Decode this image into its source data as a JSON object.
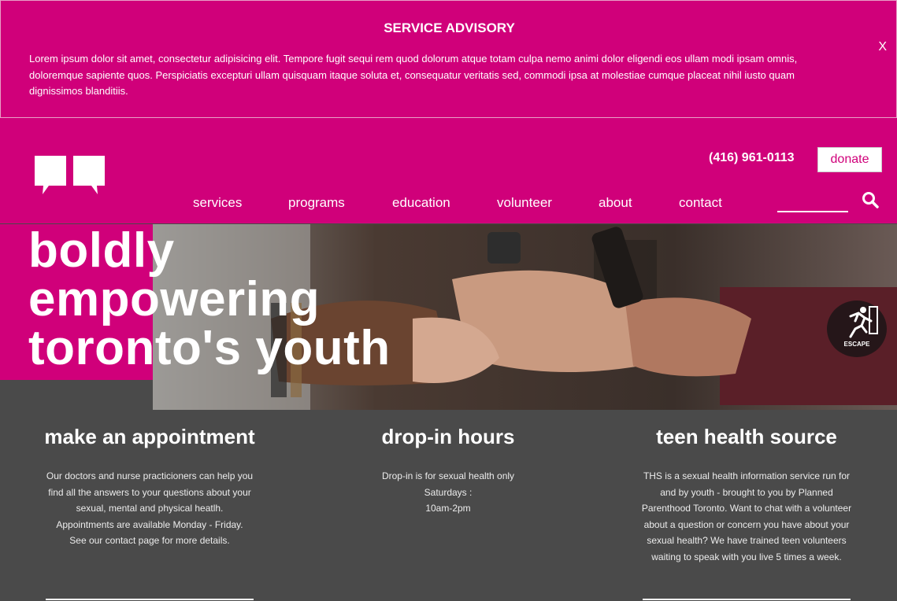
{
  "advisory": {
    "title": "SERVICE ADVISORY",
    "body": "Lorem ipsum dolor sit amet, consectetur adipisicing elit. Tempore fugit sequi rem quod dolorum atque totam culpa nemo animi dolor eligendi eos ullam modi ipsam omnis, doloremque sapiente quos. Perspiciatis excepturi ullam quisquam itaque soluta et, consequatur veritatis sed, commodi ipsa at molestiae cumque placeat nihil iusto quam dignissimos blanditiis.",
    "close_label": "X"
  },
  "header": {
    "phone": "(416) 961-0113",
    "donate_label": "donate",
    "nav": [
      "services",
      "programs",
      "education",
      "volunteer",
      "about",
      "contact"
    ],
    "search_placeholder": "",
    "logo_icon": "speech-bubbles-logo"
  },
  "hero": {
    "title": [
      "boldly",
      "empowering",
      "toronto's youth"
    ],
    "escape_label": "ESCAPE"
  },
  "columns": [
    {
      "title": "make an appointment",
      "body": [
        "Our doctors and nurse practicioners can help you",
        "find all the answers to your questions about your",
        "sexual, mental and physical heatlh.",
        "Appointments are available Monday - Friday.",
        "See our contact page for more details."
      ]
    },
    {
      "title": "drop-in hours",
      "body": [
        "Drop-in is for sexual health only",
        "Saturdays :",
        "10am-2pm"
      ]
    },
    {
      "title": "teen health source",
      "body": [
        "THS is a sexual health information service run for",
        "and by youth - brought to you by Planned",
        "Parenthood Toronto. Want to chat with a volunteer",
        "about a question or concern you have about your",
        "sexual health? We have trained teen volunteers",
        "waiting to speak with you live 5 times a week."
      ]
    }
  ],
  "colors": {
    "brand": "#d0007a",
    "footer_bg": "#4a4a4a"
  }
}
